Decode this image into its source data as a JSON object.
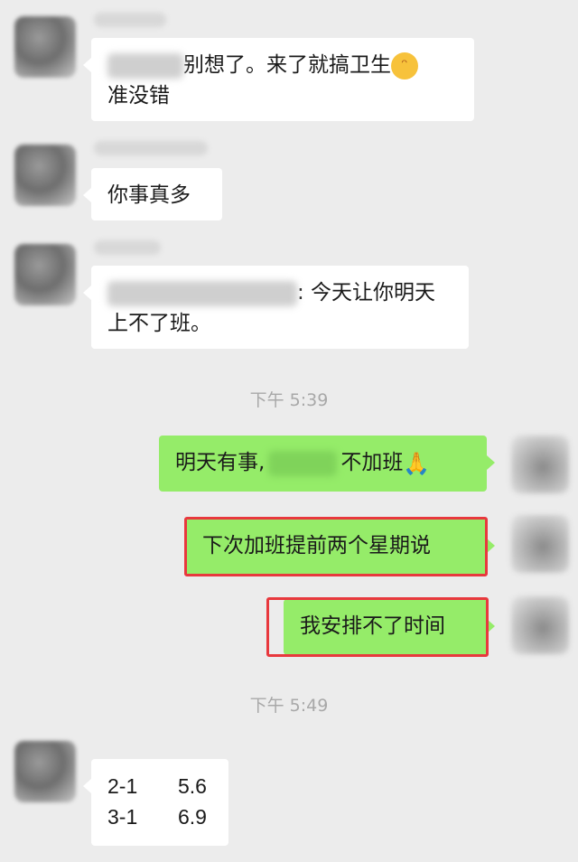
{
  "messages": [
    {
      "text_line1": "别想了。来了就搞卫生",
      "text_line2": "准没错",
      "emoji": "face-emoji"
    },
    {
      "text": "你事真多"
    },
    {
      "text_line1": ": 今天让你明天",
      "text_line2": "上不了班。"
    },
    {
      "text_before": "明天有事,",
      "text_after": "不加班",
      "emoji": "praying-hands-emoji"
    },
    {
      "text": "下次加班提前两个星期说"
    },
    {
      "text": "我安排不了时间"
    },
    {
      "rows": [
        [
          "2-1",
          "5.6"
        ],
        [
          "3-1",
          "6.9"
        ]
      ]
    }
  ],
  "timestamps": [
    "下午 5:39",
    "下午 5:49"
  ],
  "colors": {
    "background": "#ececec",
    "own_bubble": "#95ec69",
    "highlight_box": "#e8383d"
  }
}
